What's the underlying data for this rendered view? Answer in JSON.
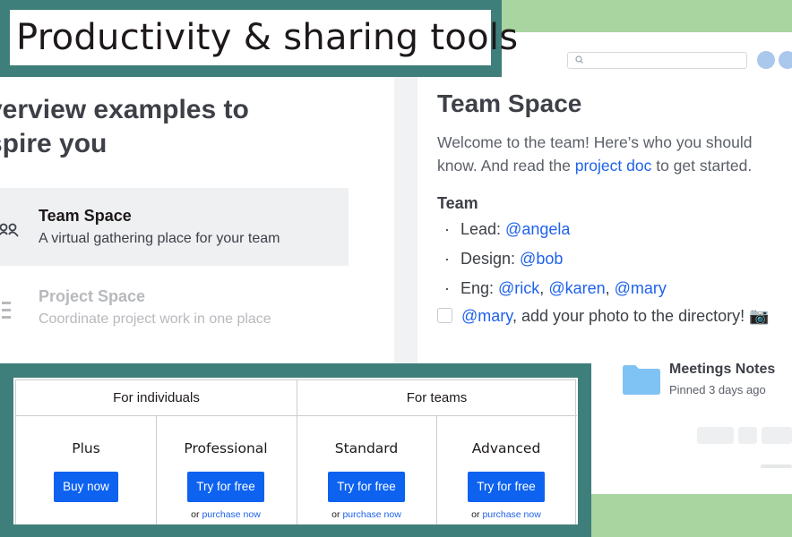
{
  "banner": {
    "title": "Productivity & sharing tools"
  },
  "left": {
    "heading_line1": "verview examples to",
    "heading_line2": "spire you",
    "templates": [
      {
        "title": "Team Space",
        "description": "A virtual gathering place for your team",
        "icon": "people-icon"
      },
      {
        "title": "Project Space",
        "description": "Coordinate project work in one place",
        "icon": "list-icon"
      }
    ]
  },
  "doc": {
    "title": "Team Space",
    "welcome_before": "Welcome to the team! Here’s who you should know. And read the ",
    "welcome_link": "project doc",
    "welcome_after": " to get started.",
    "team_heading": "Team",
    "lead_label": "Lead: ",
    "lead": "@angela",
    "design_label": "Design: ",
    "design": "@bob",
    "eng_label": "Eng: ",
    "eng_1": "@rick",
    "eng_2": "@karen",
    "eng_3": "@mary",
    "todo_mention": "@mary",
    "todo_text": ", add your photo to the directory! 📷",
    "pinned_title": "Meetings Notes",
    "pinned_sub": "Pinned 3 days ago"
  },
  "pricing": {
    "groups": [
      "For individuals",
      "For teams"
    ],
    "plans": [
      {
        "name": "Plus",
        "button": "Buy now",
        "alt_prefix": "",
        "alt_link": ""
      },
      {
        "name": "Professional",
        "button": "Try for free",
        "alt_prefix": "or ",
        "alt_link": "purchase now"
      },
      {
        "name": "Standard",
        "button": "Try for free",
        "alt_prefix": "or ",
        "alt_link": "purchase now"
      },
      {
        "name": "Advanced",
        "button": "Try for free",
        "alt_prefix": "or ",
        "alt_link": "purchase now"
      }
    ]
  },
  "colors": {
    "teal_frame": "#3f7f7b",
    "green_bg": "#a8d5a0",
    "link_blue": "#1f62ea",
    "button_blue": "#0d62f0",
    "folder_blue": "#7fc2f4"
  }
}
